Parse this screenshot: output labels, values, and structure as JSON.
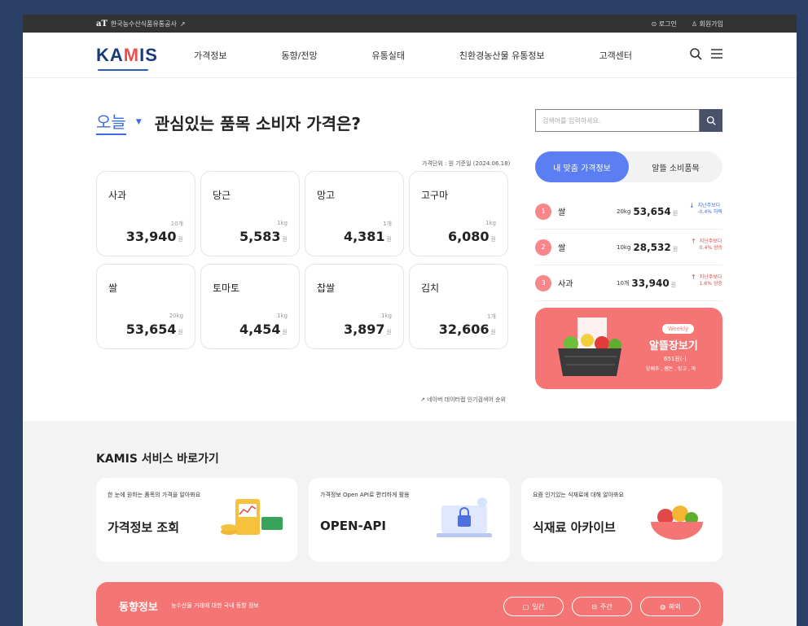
{
  "topbar": {
    "brand_mark": "aT",
    "brand_name": "한국농수산식품유통공사",
    "external_icon": "external-link-icon",
    "login": "로그인",
    "signup": "회원가입"
  },
  "nav": {
    "logo": {
      "prefix": "KA",
      "highlight": "M",
      "suffix": "IS"
    },
    "menu": [
      "가격정보",
      "동향/전망",
      "유통실태",
      "친환경농산물 유통정보",
      "고객센터"
    ],
    "icons": [
      "search-icon",
      "hamburger-menu-icon"
    ]
  },
  "hero": {
    "period": "오늘",
    "headline": "관심있는 품목 소비자 가격은?",
    "unit_note": "가격단위 : 원 기준일 (2024.06.18)",
    "cards": [
      {
        "name": "사과",
        "unit": "10개",
        "price": "33,940",
        "won": "원"
      },
      {
        "name": "당근",
        "unit": "1kg",
        "price": "5,583",
        "won": "원"
      },
      {
        "name": "망고",
        "unit": "1개",
        "price": "4,381",
        "won": "원"
      },
      {
        "name": "고구마",
        "unit": "1kg",
        "price": "6,080",
        "won": "원"
      },
      {
        "name": "쌀",
        "unit": "20kg",
        "price": "53,654",
        "won": "원"
      },
      {
        "name": "토마토",
        "unit": "1kg",
        "price": "4,454",
        "won": "원"
      },
      {
        "name": "찹쌀",
        "unit": "1kg",
        "price": "3,897",
        "won": "원"
      },
      {
        "name": "김치",
        "unit": "1개",
        "price": "32,606",
        "won": "원"
      }
    ],
    "naver_note": "네이버 데이터랩 인기검색어 순위"
  },
  "search": {
    "placeholder": "검색어를 입력하세요."
  },
  "tabs": [
    "내 맞춤 가격정보",
    "알뜰 소비품목"
  ],
  "ranks": [
    {
      "num": "1",
      "name": "쌀",
      "unit": "20kg",
      "price": "53,654",
      "won": "원",
      "change_line1": "지난주보다",
      "change_line2": "-0.4% 하락",
      "direction": "down"
    },
    {
      "num": "2",
      "name": "쌀",
      "unit": "10kg",
      "price": "28,532",
      "won": "원",
      "change_line1": "지난주보다",
      "change_line2": "0.4% 상승",
      "direction": "up"
    },
    {
      "num": "3",
      "name": "사과",
      "unit": "10개",
      "price": "33,940",
      "won": "원",
      "change_line1": "지난주보다",
      "change_line2": "1.6% 상승",
      "direction": "up"
    }
  ],
  "weekly": {
    "badge": "Weekly",
    "title": "알뜰장보기",
    "count": "651원(-)",
    "items": "양배추 , 쌤돈 , 망고 , 파"
  },
  "services": {
    "title": "KAMIS 서비스 바로가기",
    "cards": [
      {
        "sub": "한 눈에 원하는 품목의 가격을 알아봐요",
        "name": "가격정보 조회"
      },
      {
        "sub": "가격정보 Open API로 편리하게 활용",
        "name": "OPEN-API"
      },
      {
        "sub": "요즘 인기있는 식재료에 대해 알아봐요",
        "name": "식재료 아카이브"
      }
    ]
  },
  "trend": {
    "title": "동향정보",
    "subtitle": "농수산물 거래에 대한 국내 동향 정보",
    "buttons": [
      "일간",
      "주간",
      "해외"
    ]
  },
  "colors": {
    "accent_blue": "#5b7ef2",
    "accent_red": "#f57575",
    "navy": "#1a3a7a"
  }
}
